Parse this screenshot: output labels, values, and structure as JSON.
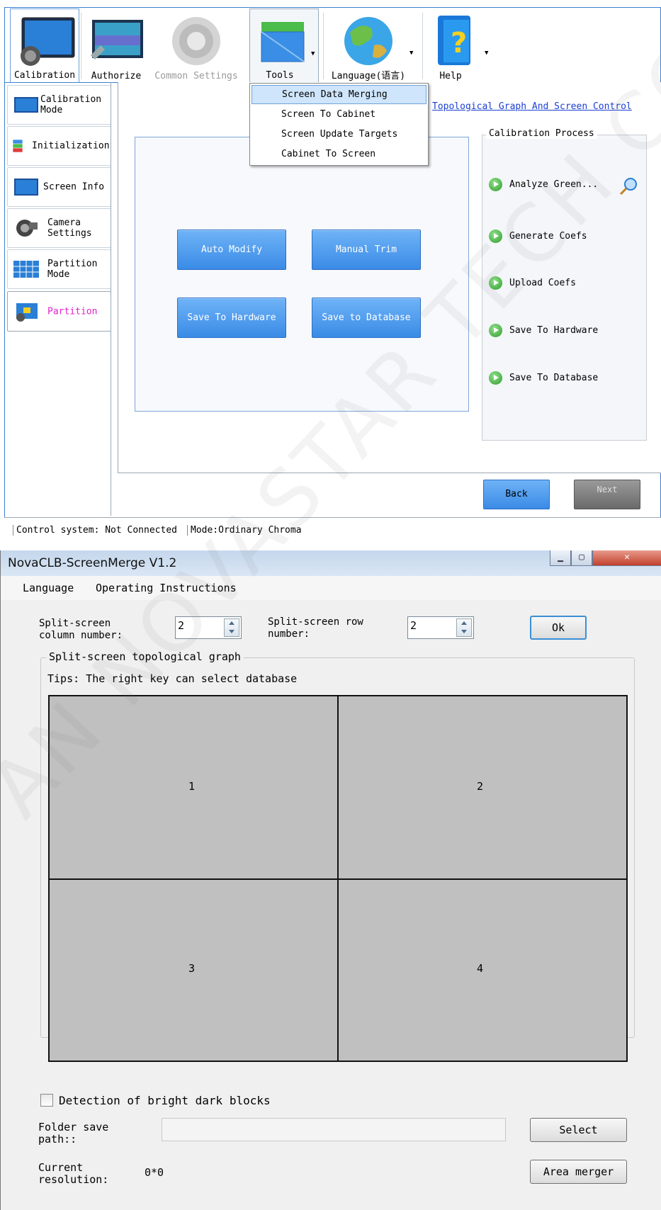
{
  "top_app": {
    "toolbar": {
      "calibration": "Calibration",
      "authorize": "Authorize",
      "common_settings": "Common Settings",
      "tools": "Tools",
      "language": "Language(语言)",
      "help": "Help"
    },
    "tools_menu": [
      "Screen Data Merging",
      "Screen To Cabinet",
      "Screen Update Targets",
      "Cabinet To Screen"
    ],
    "sidebar": [
      {
        "label": "Calibration\nMode",
        "icon": "monitor-icon"
      },
      {
        "label": "Initialization",
        "icon": "database-icon"
      },
      {
        "label": "Screen Info",
        "icon": "screen-icon"
      },
      {
        "label": "Camera\nSettings",
        "icon": "camera-icon"
      },
      {
        "label": "Partition\nMode",
        "icon": "grid-icon"
      },
      {
        "label": "Partition",
        "icon": "partition-icon"
      }
    ],
    "topo_link": "Topological Graph And Screen Control",
    "actions": {
      "auto_modify": "Auto Modify",
      "manual_trim": "Manual Trim",
      "save_hardware": "Save To Hardware",
      "save_database": "Save to Database"
    },
    "process": {
      "title": "Calibration Process",
      "steps": [
        "Analyze Green...",
        "Generate Coefs",
        "Upload Coefs",
        "Save To Hardware",
        "Save To Database"
      ]
    },
    "back": "Back",
    "next": "Next",
    "status": {
      "control": "Control system: Not Connected",
      "mode": "Mode:Ordinary Chroma"
    },
    "colors": {
      "accent": "#3c7fd1",
      "active_text": "#e020c8",
      "link": "#1a3fd4"
    }
  },
  "merge_app": {
    "title": "NovaCLB-ScreenMerge V1.2",
    "menu": [
      "Language",
      "Operating Instructions"
    ],
    "col_label": "Split-screen\ncolumn number:",
    "col_value": "2",
    "row_label": "Split-screen row\nnumber:",
    "row_value": "2",
    "ok": "Ok",
    "group_title": "Split-screen topological graph",
    "tips": "Tips: The right key can select database",
    "cells": [
      "1",
      "2",
      "3",
      "4"
    ],
    "detect_label": "Detection of bright dark blocks",
    "folder_label": "Folder save\npath::",
    "folder_value": "",
    "select": "Select",
    "res_label": "Current\nresolution:",
    "res_value": "0*0",
    "area_merger": "Area merger"
  },
  "watermark": "AN NOVASTAR TECH CO.,L"
}
